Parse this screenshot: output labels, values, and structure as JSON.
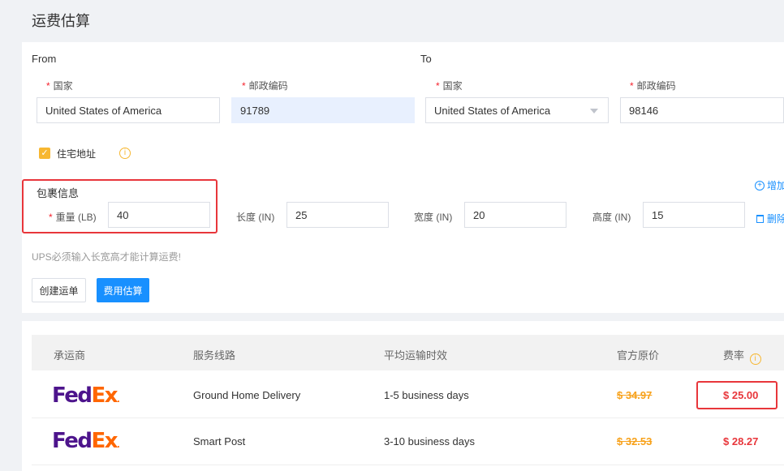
{
  "page_title": "运费估算",
  "from": {
    "label": "From",
    "country_label": "国家",
    "zip_label": "邮政编码",
    "country_value": "United States of America",
    "zip_value": "91789"
  },
  "to": {
    "label": "To",
    "country_label": "国家",
    "zip_label": "邮政编码",
    "country_value": "United States of America",
    "zip_value": "98146"
  },
  "residential": {
    "label": "住宅地址",
    "checked": true,
    "info_icon": "info-icon"
  },
  "package": {
    "title": "包裹信息",
    "weight_label": "重量 (LB)",
    "weight_value": "40",
    "length_label": "长度 (IN)",
    "length_value": "25",
    "width_label": "宽度 (IN)",
    "width_value": "20",
    "height_label": "高度 (IN)",
    "height_value": "15",
    "add_label": "增加",
    "delete_label": "删除"
  },
  "hint": "UPS必须输入长宽高才能计算运费!",
  "buttons": {
    "create": "创建运单",
    "estimate": "费用估算"
  },
  "table": {
    "headers": [
      "承运商",
      "服务线路",
      "平均运输时效",
      "官方原价",
      "费率"
    ],
    "rows": [
      {
        "carrier": "FedEx",
        "service": "Ground Home Delivery",
        "transit": "1-5 business days",
        "official_price": "$ 34.97",
        "rate": "$ 25.00"
      },
      {
        "carrier": "FedEx",
        "service": "Smart Post",
        "transit": "3-10 business days",
        "official_price": "$ 32.53",
        "rate": "$ 28.27"
      }
    ]
  },
  "colors": {
    "accent": "#1890ff",
    "highlight_red": "#e8363b",
    "price_orange": "#f7a11a",
    "fedex_purple": "#4d148c",
    "fedex_orange": "#ff6600"
  }
}
